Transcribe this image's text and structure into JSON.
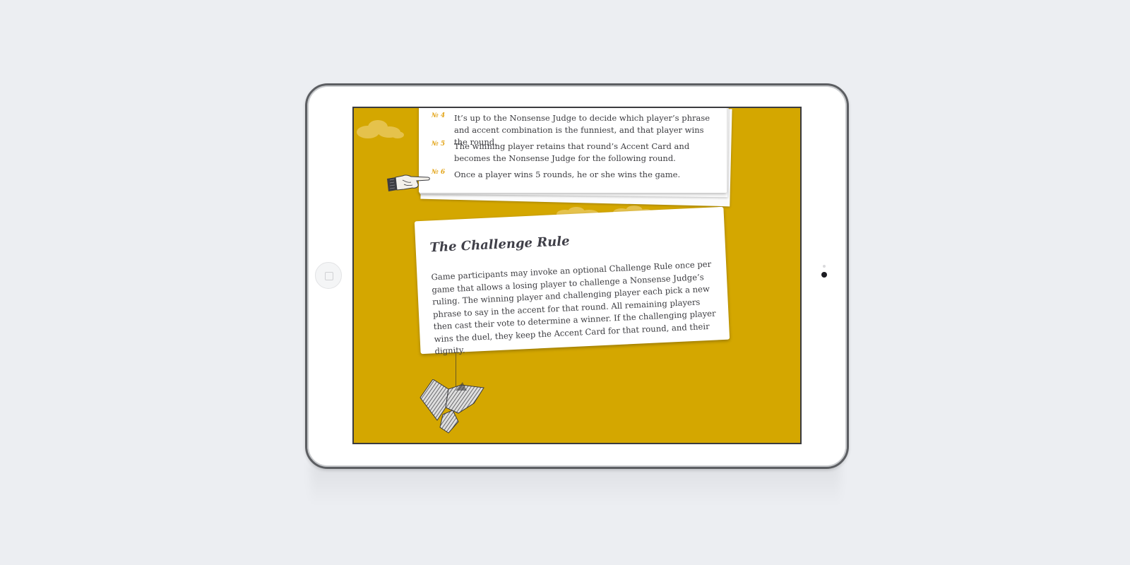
{
  "rules": [
    {
      "number": "№ 4",
      "text": "It’s up to the Nonsense Judge to decide which player’s phrase and accent combination is the funniest, and that player wins the round."
    },
    {
      "number": "№ 5",
      "text": "The winning player retains that round’s Accent Card and becomes the Nonsense Judge for the following round."
    },
    {
      "number": "№ 6",
      "text": "Once a player wins 5 rounds, he or she wins the game."
    }
  ],
  "challenge": {
    "title": "The Challenge Rule",
    "body": "Game participants may invoke an optional Challenge Rule once per game that allows a losing player to challenge a Nonsense Judge’s ruling. The winning player and challenging player each pick a new phrase to say in the accent for that round. All remaining players then cast their vote to determine a winner. If the challenging player wins the duel, they keep the Accent Card for that round, and their dignity."
  },
  "colors": {
    "background": "#d4a700",
    "rule_number": "#e3a51a",
    "text": "#3c3c40",
    "page": "#eceef2"
  },
  "icons": {
    "hand": "pointing-hand-icon",
    "birds": "hanging-birds-icon",
    "cloud": "cloud-icon"
  }
}
